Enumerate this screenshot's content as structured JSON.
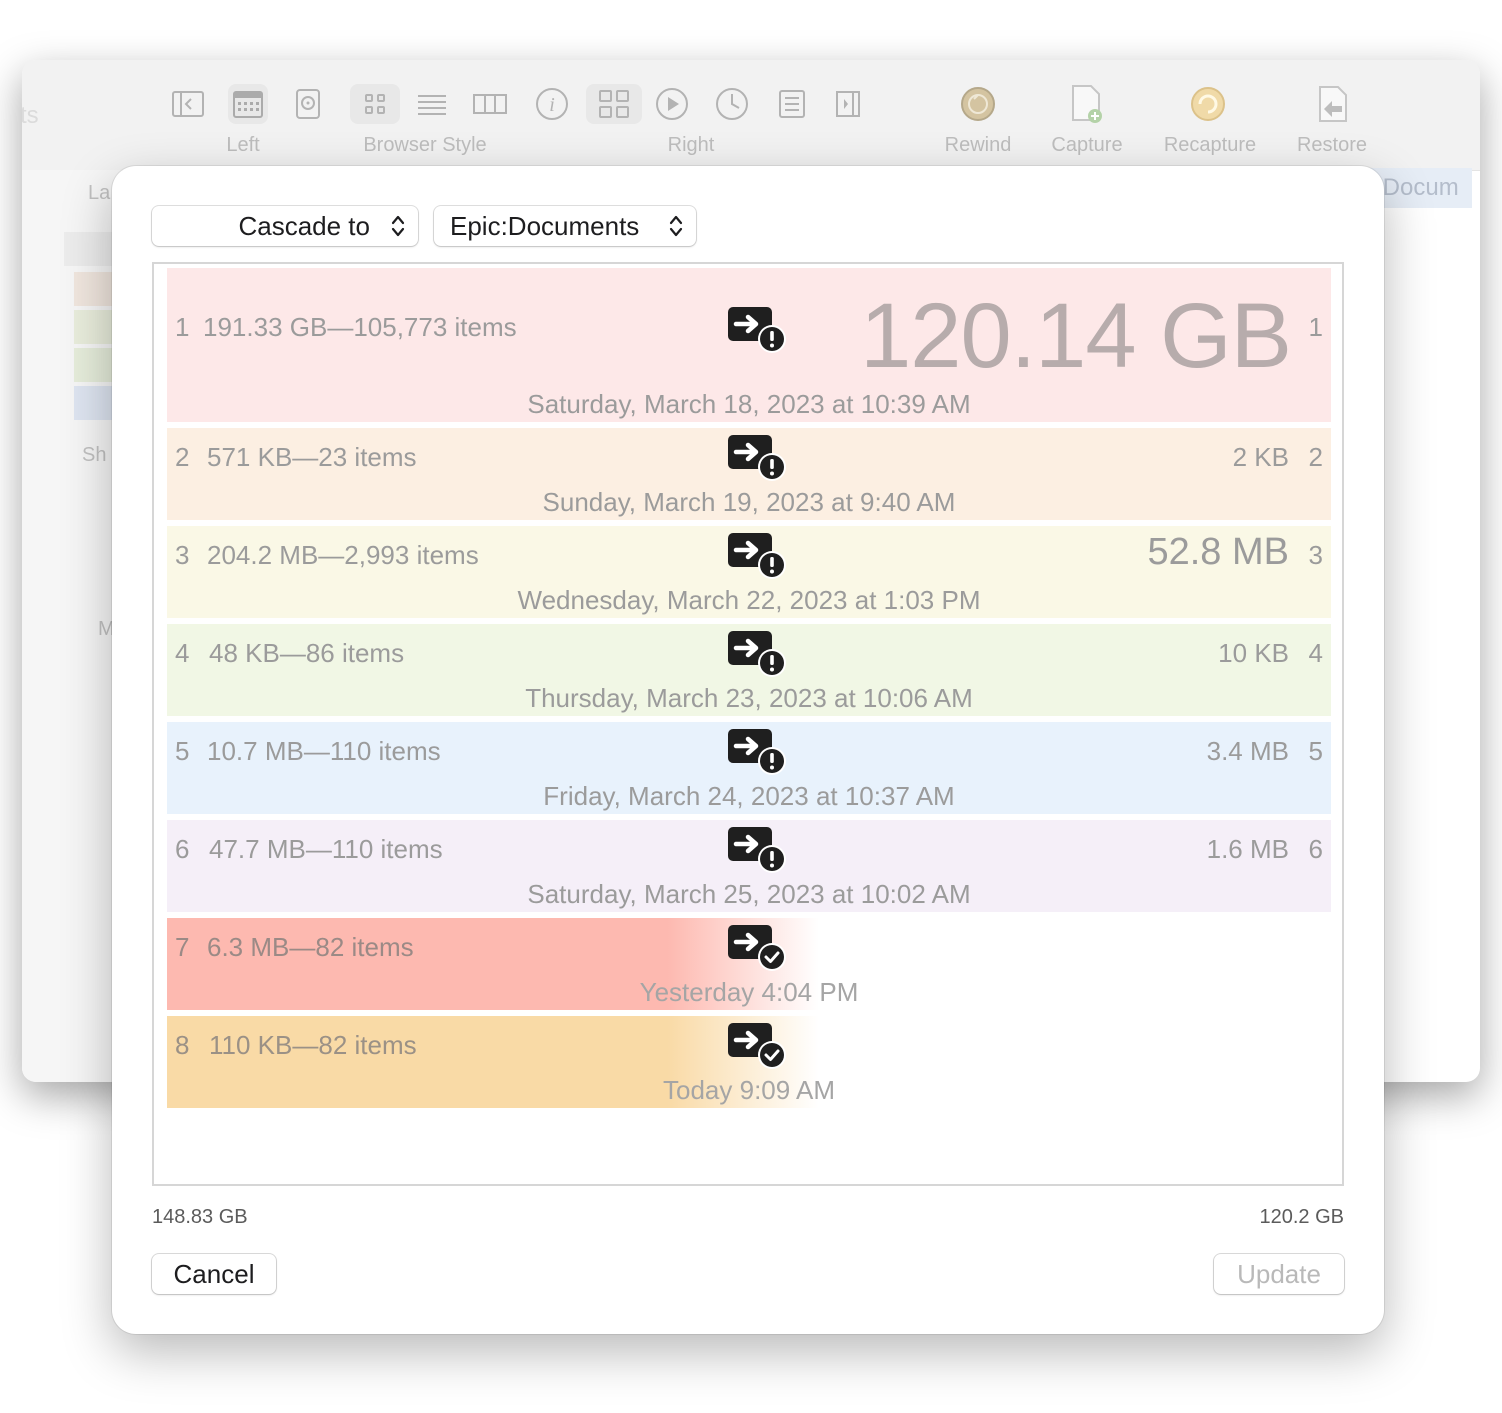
{
  "background_window": {
    "toolbar_groups": [
      {
        "label": "Left"
      },
      {
        "label": "Browser Style"
      },
      {
        "label": "Right"
      },
      {
        "label": "Rewind"
      },
      {
        "label": "Capture"
      },
      {
        "label": "Recapture"
      },
      {
        "label": "Restore"
      }
    ],
    "sidebar_texts": [
      "La",
      "Sh",
      "M"
    ],
    "path_fragment": ":Docum",
    "left_edge_fragment": "ts"
  },
  "sheet": {
    "mode_popup": "Cascade to",
    "target_popup": "Epic:Documents",
    "rows": [
      {
        "index": "1",
        "size": "191.33 GB—105,773 items",
        "delta": "120.14 GB",
        "date": "Saturday, March 18, 2023 at 10:39 AM",
        "status": "warning",
        "color": "#fde8e8"
      },
      {
        "index": "2",
        "size": "571 KB—23 items",
        "delta": "2 KB",
        "date": "Sunday, March 19, 2023 at 9:40 AM",
        "status": "warning",
        "color": "#fcefe2"
      },
      {
        "index": "3",
        "size": "204.2 MB—2,993 items",
        "delta": "52.8 MB",
        "date": "Wednesday, March 22, 2023 at 1:03 PM",
        "status": "warning",
        "color": "#faf8e6"
      },
      {
        "index": "4",
        "size": "48 KB—86 items",
        "delta": "10 KB",
        "date": "Thursday, March 23, 2023 at 10:06 AM",
        "status": "warning",
        "color": "#f1f7e5"
      },
      {
        "index": "5",
        "size": "10.7 MB—110 items",
        "delta": "3.4 MB",
        "date": "Friday, March 24, 2023 at 10:37 AM",
        "status": "warning",
        "color": "#e8f2fc"
      },
      {
        "index": "6",
        "size": "47.7 MB—110 items",
        "delta": "1.6 MB",
        "date": "Saturday, March 25, 2023 at 10:02 AM",
        "status": "warning",
        "color": "#f5eff8"
      },
      {
        "index": "7",
        "size": "6.3 MB—82 items",
        "delta": "",
        "date": "Yesterday 4:04 PM",
        "status": "ok",
        "color": "#fdb9b0"
      },
      {
        "index": "8",
        "size": "110 KB—82 items",
        "delta": "",
        "date": "Today 9:09 AM",
        "status": "ok",
        "color": "#f9daa6"
      }
    ],
    "total_left": "148.83 GB",
    "total_right": "120.2 GB",
    "cancel_label": "Cancel",
    "update_label": "Update"
  }
}
